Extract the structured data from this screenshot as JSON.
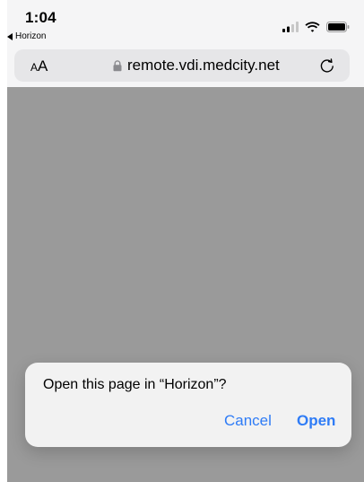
{
  "status_bar": {
    "time": "1:04",
    "back_app_label": "Horizon",
    "icons": [
      "signal-icon",
      "wifi-icon",
      "battery-icon"
    ]
  },
  "address_bar": {
    "text_size_label_small": "A",
    "text_size_label_large": "A",
    "url": "remote.vdi.medcity.net",
    "icons": [
      "lock-icon",
      "reload-icon"
    ]
  },
  "page": {
    "background_color": "#9a9a9a"
  },
  "dialog": {
    "message": "Open this page in “Horizon”?",
    "cancel_label": "Cancel",
    "open_label": "Open",
    "accent_color": "#2f7cf6"
  }
}
